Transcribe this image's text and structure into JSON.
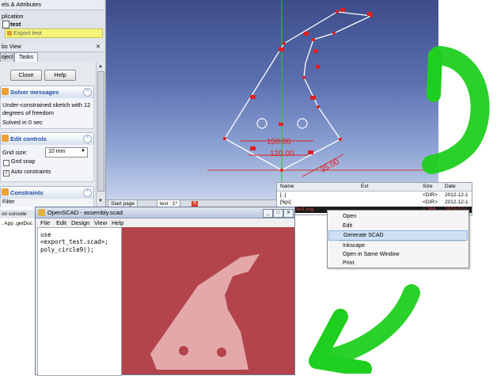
{
  "freecad": {
    "tree": {
      "header": "els & Attributes",
      "application": "plication",
      "document": "test",
      "selected_item": "Export test"
    },
    "combo_view": {
      "title": "bo View",
      "tabs": [
        "oject",
        "Tasks"
      ],
      "close_button": "Close",
      "help_button": "Help",
      "solver_messages": {
        "title": "Solver messages",
        "message": "Under-constrained sketch with 12 degrees of freedom",
        "status": "Solved in 0 sec"
      },
      "edit_controls": {
        "title": "Edit controls",
        "grid_size_label": "Grid size:",
        "grid_size_value": "10 mm",
        "grid_snap_label": "Grid snap",
        "grid_snap_checked": false,
        "auto_constraints_label": "Auto constraints",
        "auto_constraints_checked": true
      },
      "constraints": {
        "title": "Constraints",
        "filter_label": "Filter"
      }
    },
    "view_tabs": [
      "Start page",
      "test : 1*"
    ],
    "dimensions": [
      "150.00",
      "120.00",
      "35.00"
    ],
    "report_console": {
      "title": "on console",
      "line": ". App .getDoc"
    }
  },
  "file_manager": {
    "columns": [
      "Name",
      "Ext",
      "Size",
      "Date"
    ],
    "rows": [
      {
        "name": "[..]",
        "ext": "",
        "size": "<DIR>",
        "date": "2012-12-1"
      },
      {
        "name": "[figs]",
        "ext": "",
        "size": "<DIR>",
        "date": "2012-12-1"
      },
      {
        "name": "test.svg",
        "ext": "",
        "size": "1,268",
        "date": "2012-12-1"
      }
    ]
  },
  "context_menu": {
    "items": [
      "Open",
      "Edit",
      "Generate SCAD",
      "Inkscape",
      "Open in Same Window",
      "Print"
    ],
    "highlighted": "Generate SCAD"
  },
  "openscad": {
    "title": "OpenSCAD - assembly.scad",
    "menu": [
      "File",
      "Edit",
      "Design",
      "View",
      "Help"
    ],
    "code_lines": [
      "use <export_test.scad>;",
      "",
      "poly_circle9();"
    ]
  },
  "colors": {
    "sketch_red": "#e02020",
    "preview_bg": "#b3444b",
    "preview_shape": "#e4a8ab",
    "arrow_green": "#1fcf1f",
    "highlight_yellow": "#f4f47a"
  }
}
